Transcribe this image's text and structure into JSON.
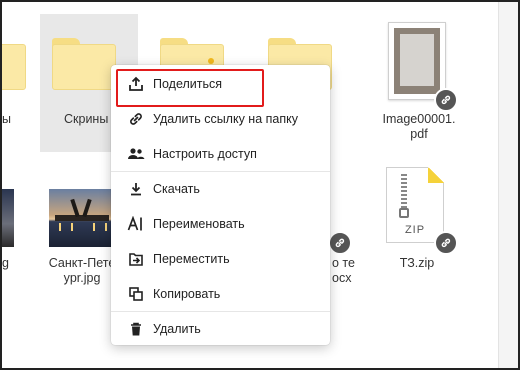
{
  "tiles": {
    "top_left_partial_label": "ы",
    "selected_folder_label": "Скрины",
    "doc_name_line1": "Image00001.",
    "doc_name_line2": "pdf",
    "left_partial_bottom_label": "g",
    "photo_label_line1": "Санкт-Пете",
    "photo_label_line2": "ypr.jpg",
    "hidden_label_line1": "о те",
    "hidden_label_line2": "осх",
    "zip_label": "ТЗ.zip",
    "zip_icon_text": "ZIP"
  },
  "context_menu": {
    "items": [
      {
        "label": "Поделиться",
        "icon": "share-upload-icon"
      },
      {
        "label": "Удалить ссылку на папку",
        "icon": "link-icon"
      },
      {
        "label": "Настроить доступ",
        "icon": "people-icon"
      },
      {
        "label": "Скачать",
        "icon": "download-icon"
      },
      {
        "label": "Переименовать",
        "icon": "rename-icon"
      },
      {
        "label": "Переместить",
        "icon": "move-icon"
      },
      {
        "label": "Копировать",
        "icon": "copy-icon"
      },
      {
        "label": "Удалить",
        "icon": "trash-icon"
      }
    ],
    "highlighted_index": 0
  },
  "colors": {
    "folder": "#fbe9a6",
    "highlight_border": "#e21b1b",
    "selected_bg": "#e8e8e8",
    "link_badge": "#555555"
  }
}
